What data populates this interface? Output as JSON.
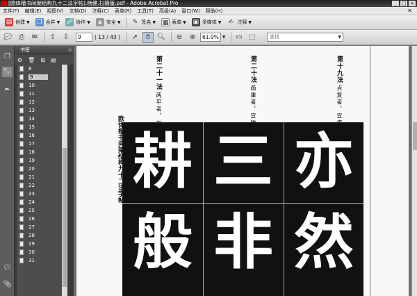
{
  "window": {
    "title": "[欧体楷书间架结构九十二法字帖].杨健.扫描版.pdf - Adobe Acrobat Pro"
  },
  "menu": [
    "文件(F)",
    "编辑(E)",
    "视图(V)",
    "文档(D)",
    "注释(C)",
    "表单(R)",
    "工具(T)",
    "高级(A)",
    "窗口(W)",
    "帮助(H)"
  ],
  "toolbar1": {
    "create": "创建",
    "combine": "合并",
    "collaborate": "协作",
    "secure": "安全",
    "sign": "签名",
    "forms": "表单",
    "multimedia": "多媒体",
    "comment": "注释"
  },
  "navigation": {
    "current_page": "9",
    "page_count": "( 13 / 43 )",
    "zoom": "61.9%",
    "search_placeholder": "查找"
  },
  "bookmarks": {
    "title": "书签",
    "items": [
      "8",
      "9",
      "10",
      "11",
      "12",
      "13",
      "14",
      "15",
      "16",
      "17",
      "18",
      "19",
      "20",
      "21",
      "22",
      "23",
      "24",
      "25",
      "26",
      "27",
      "28",
      "29",
      "30",
      "31"
    ],
    "selected": "9"
  },
  "document": {
    "spine_text": "欧体楷书间架结构九十二法字帖",
    "rules": [
      {
        "title": "第十九法",
        "desc": "点复者，宜偡仰向背以求变。"
      },
      {
        "title": "第二十法",
        "desc": "画重者，宜腾羽参差以化板。"
      },
      {
        "title": "第二十一法",
        "desc": "两平者，左右宜均。"
      }
    ],
    "characters": [
      "耕",
      "三",
      "亦",
      "般",
      "非",
      "然"
    ]
  }
}
